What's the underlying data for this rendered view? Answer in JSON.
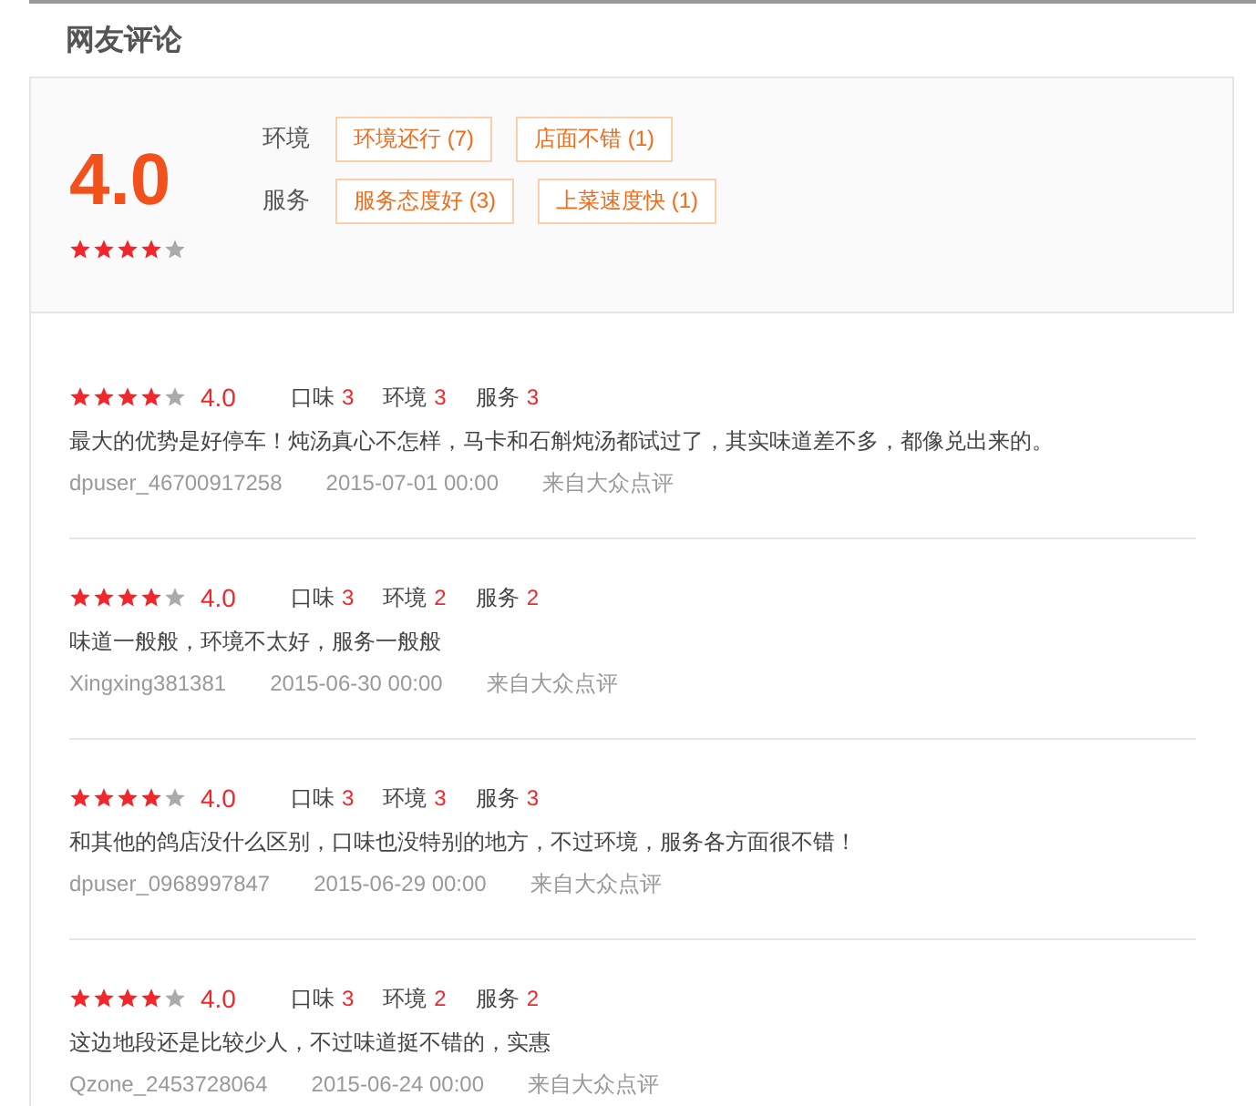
{
  "title": "网友评论",
  "summary": {
    "rating": "4.0",
    "stars": 4,
    "groups": [
      {
        "label": "环境",
        "tags": [
          "环境还行 (7)",
          "店面不错 (1)"
        ]
      },
      {
        "label": "服务",
        "tags": [
          "服务态度好 (3)",
          "上菜速度快 (1)"
        ]
      }
    ]
  },
  "reviews": [
    {
      "stars": 4,
      "rating": "4.0",
      "scores": [
        {
          "label": "口味",
          "value": "3"
        },
        {
          "label": "环境",
          "value": "3"
        },
        {
          "label": "服务",
          "value": "3"
        }
      ],
      "text": "最大的优势是好停车！炖汤真心不怎样，马卡和石斛炖汤都试过了，其实味道差不多，都像兑出来的。",
      "user": "dpuser_46700917258",
      "date": "2015-07-01 00:00",
      "source": "来自大众点评"
    },
    {
      "stars": 4,
      "rating": "4.0",
      "scores": [
        {
          "label": "口味",
          "value": "3"
        },
        {
          "label": "环境",
          "value": "2"
        },
        {
          "label": "服务",
          "value": "2"
        }
      ],
      "text": "味道一般般，环境不太好，服务一般般",
      "user": "Xingxing381381",
      "date": "2015-06-30 00:00",
      "source": "来自大众点评"
    },
    {
      "stars": 4,
      "rating": "4.0",
      "scores": [
        {
          "label": "口味",
          "value": "3"
        },
        {
          "label": "环境",
          "value": "3"
        },
        {
          "label": "服务",
          "value": "3"
        }
      ],
      "text": "和其他的鸽店没什么区别，口味也没特别的地方，不过环境，服务各方面很不错！",
      "user": "dpuser_0968997847",
      "date": "2015-06-29 00:00",
      "source": "来自大众点评"
    },
    {
      "stars": 4,
      "rating": "4.0",
      "scores": [
        {
          "label": "口味",
          "value": "3"
        },
        {
          "label": "环境",
          "value": "2"
        },
        {
          "label": "服务",
          "value": "2"
        }
      ],
      "text": "这边地段还是比较少人，不过味道挺不错的，实惠",
      "user": "Qzone_2453728064",
      "date": "2015-06-24 00:00",
      "source": "来自大众点评"
    }
  ]
}
